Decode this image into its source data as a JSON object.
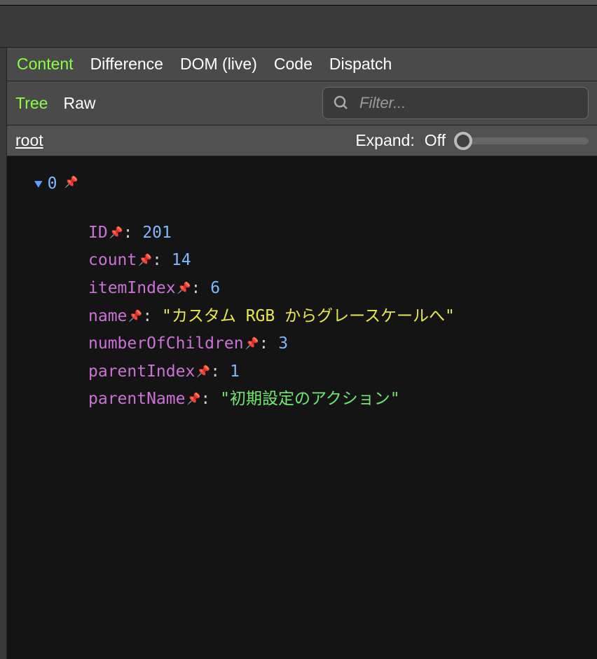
{
  "tabs_main": {
    "content": "Content",
    "difference": "Difference",
    "dom": "DOM (live)",
    "code": "Code",
    "dispatch": "Dispatch"
  },
  "sub_tabs": {
    "tree": "Tree",
    "raw": "Raw"
  },
  "filter": {
    "placeholder": "Filter..."
  },
  "breadcrumb": {
    "root": "root"
  },
  "expand": {
    "label": "Expand:",
    "state": "Off"
  },
  "tree": {
    "index": "0",
    "entries": [
      {
        "key": "ID",
        "value": "201",
        "vtype": "num"
      },
      {
        "key": "count",
        "value": "14",
        "vtype": "num"
      },
      {
        "key": "itemIndex",
        "value": "6",
        "vtype": "num"
      },
      {
        "key": "name",
        "value": "\"カスタム RGB からグレースケールへ\"",
        "vtype": "str"
      },
      {
        "key": "numberOfChildren",
        "value": "3",
        "vtype": "num"
      },
      {
        "key": "parentIndex",
        "value": "1",
        "vtype": "num"
      },
      {
        "key": "parentName",
        "value": "\"初期設定のアクション\"",
        "vtype": "str-alt"
      }
    ]
  }
}
